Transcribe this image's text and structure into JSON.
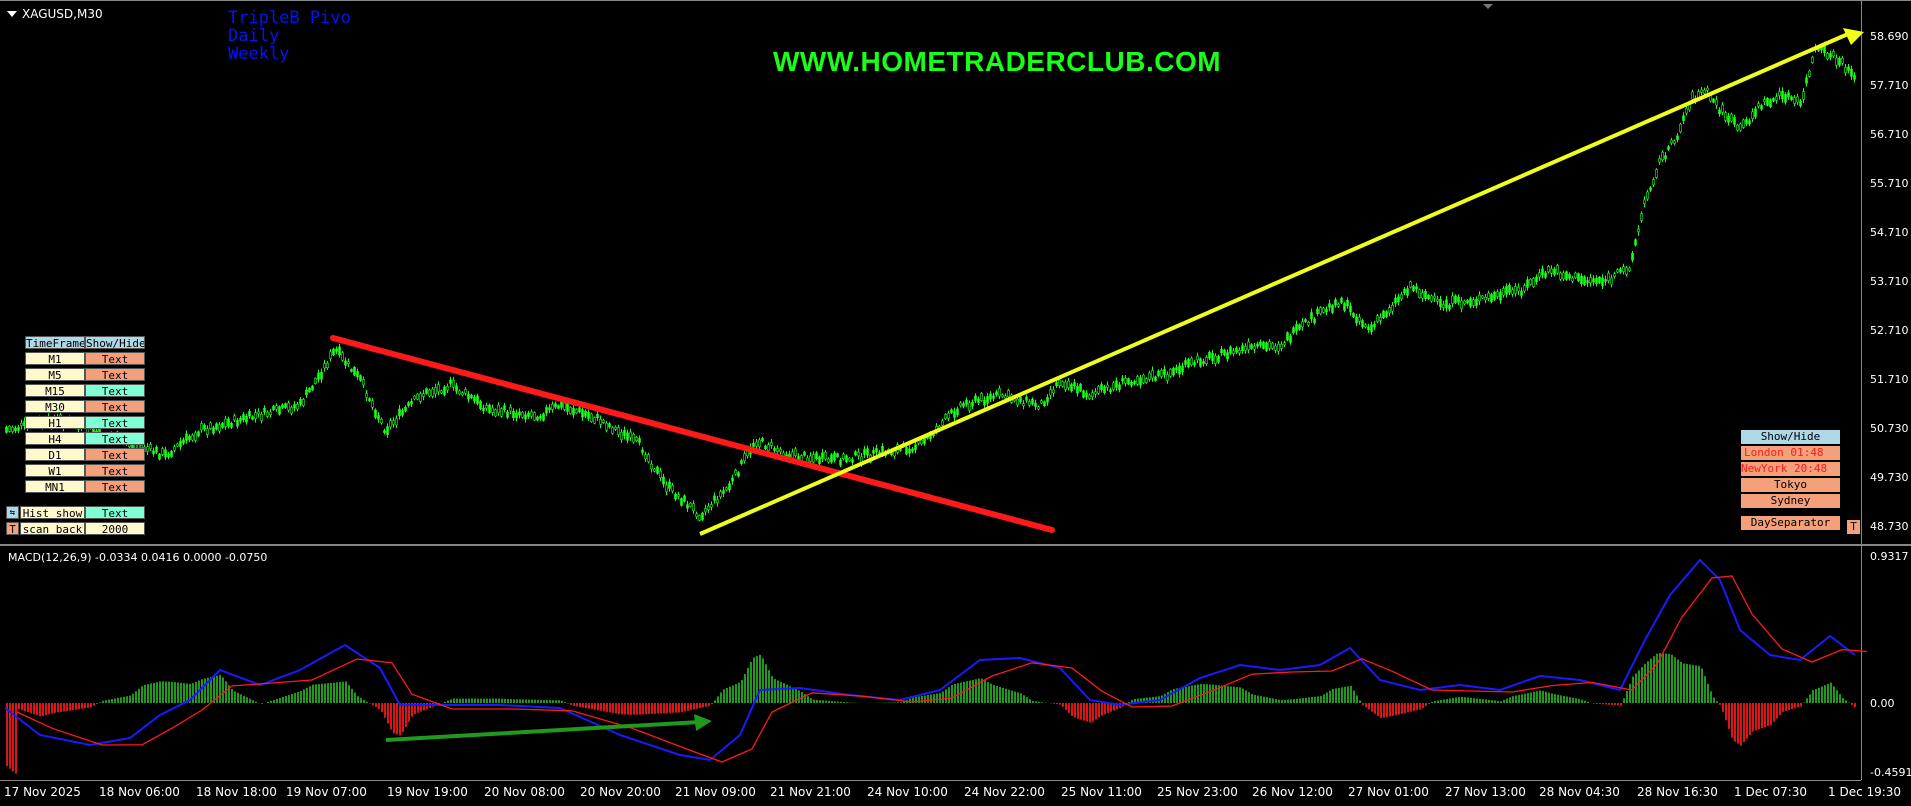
{
  "chart": {
    "symbol": "XAGUSD,M30",
    "watermark": "WWW.HOMETRADERCLUB.COM",
    "pivot_labels": [
      "TripleB Pivo",
      "Daily",
      "Weekly"
    ],
    "price_ticks": [
      "58.690",
      "57.710",
      "56.710",
      "55.710",
      "54.710",
      "53.710",
      "52.710",
      "51.710",
      "50.730",
      "49.730",
      "48.730"
    ],
    "time_ticks": [
      "17 Nov 2025",
      "18 Nov 06:00",
      "18 Nov 18:00",
      "19 Nov 07:00",
      "19 Nov 19:00",
      "20 Nov 08:00",
      "20 Nov 20:00",
      "21 Nov 09:00",
      "21 Nov 21:00",
      "24 Nov 10:00",
      "24 Nov 22:00",
      "25 Nov 11:00",
      "25 Nov 23:00",
      "26 Nov 12:00",
      "27 Nov 01:00",
      "27 Nov 13:00",
      "28 Nov 04:30",
      "28 Nov 16:30",
      "1 Dec 07:30",
      "1 Dec 19:30"
    ]
  },
  "macd": {
    "label": "MACD(12,26,9) -0.0334 0.0416 0.0000 -0.0750",
    "ticks": [
      "0.9317",
      "0.00",
      "-0.4591"
    ]
  },
  "timeframe_panel": {
    "header": [
      "TimeFrame",
      "Show/Hide"
    ],
    "rows": [
      {
        "tf": "M1",
        "val": "Text"
      },
      {
        "tf": "M5",
        "val": "Text"
      },
      {
        "tf": "M15",
        "val": "Text"
      },
      {
        "tf": "M30",
        "val": "Text"
      },
      {
        "tf": "H1",
        "val": "Text"
      },
      {
        "tf": "H4",
        "val": "Text"
      },
      {
        "tf": "D1",
        "val": "Text"
      },
      {
        "tf": "W1",
        "val": "Text"
      },
      {
        "tf": "MN1",
        "val": "Text"
      }
    ],
    "hist_show": {
      "label": "Hist show",
      "val": "Text"
    },
    "scan_back": {
      "label": "scan back",
      "val": "2000"
    },
    "t_button": "T"
  },
  "session_panel": {
    "header": "Show/Hide",
    "london": "London  01:48",
    "newyork": "NewYork  20:48",
    "tokyo": "Tokyo",
    "sydney": "Sydney",
    "day_separator": "DaySeparator",
    "t_button": "T"
  },
  "colors": {
    "candle": "#19ff19",
    "trend_down": "#ff1a1a",
    "trend_up": "#f0ff1a",
    "macd_line": "#1a1aff",
    "signal_line": "#ff1a1a",
    "hist_pos": "#1f9a1f",
    "hist_neg": "#e01414",
    "divergence": "#1f9a1f"
  }
}
